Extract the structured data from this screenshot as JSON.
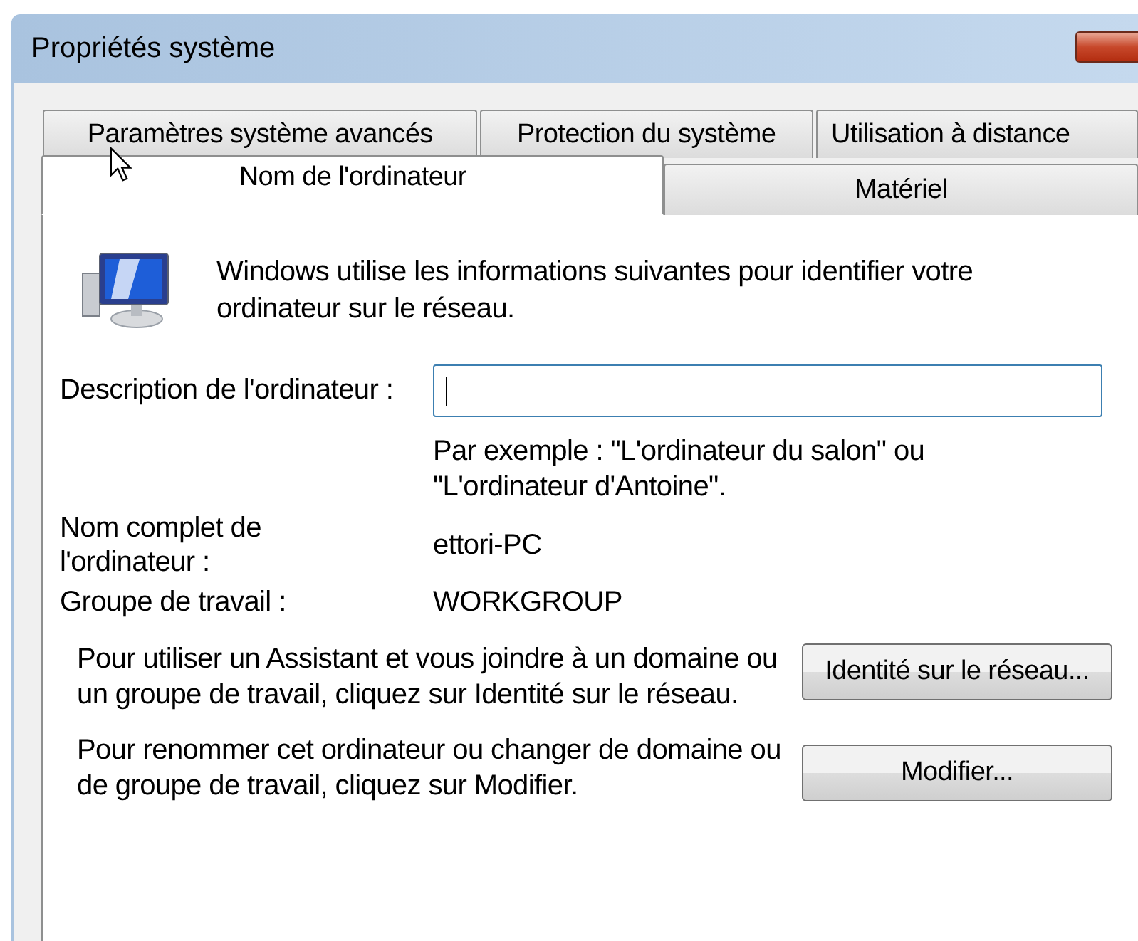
{
  "window": {
    "title": "Propriétés système"
  },
  "tab_rows": [
    {
      "tabs": [
        {
          "label": "Paramètres système avancés",
          "selected": false
        },
        {
          "label": "Protection du système",
          "selected": false
        },
        {
          "label": "Utilisation à distance",
          "selected": false
        }
      ]
    },
    {
      "tabs": [
        {
          "label": "Nom de l'ordinateur",
          "selected": true
        },
        {
          "label": "Matériel",
          "selected": false
        }
      ]
    }
  ],
  "intro": "Windows utilise les informations suivantes pour identifier votre ordinateur sur le réseau.",
  "description": {
    "label": "Description de l'ordinateur :",
    "focused": true,
    "hint": "Par exemple : \"L'ordinateur du salon\" ou \"L'ordinateur d'Antoine\"."
  },
  "fields": [
    {
      "label": "Nom complet de l'ordinateur :",
      "value": "ettori-PC"
    },
    {
      "label": "Groupe de travail :",
      "value": "WORKGROUP"
    }
  ],
  "actions": [
    {
      "text": "Pour utiliser un Assistant et vous joindre à un domaine ou un groupe de travail, cliquez sur Identité sur le réseau.",
      "button": "Identité sur le réseau..."
    },
    {
      "text": "Pour renommer cet ordinateur ou changer de domaine ou de groupe de travail, cliquez sur Modifier.",
      "button": "Modifier..."
    }
  ]
}
